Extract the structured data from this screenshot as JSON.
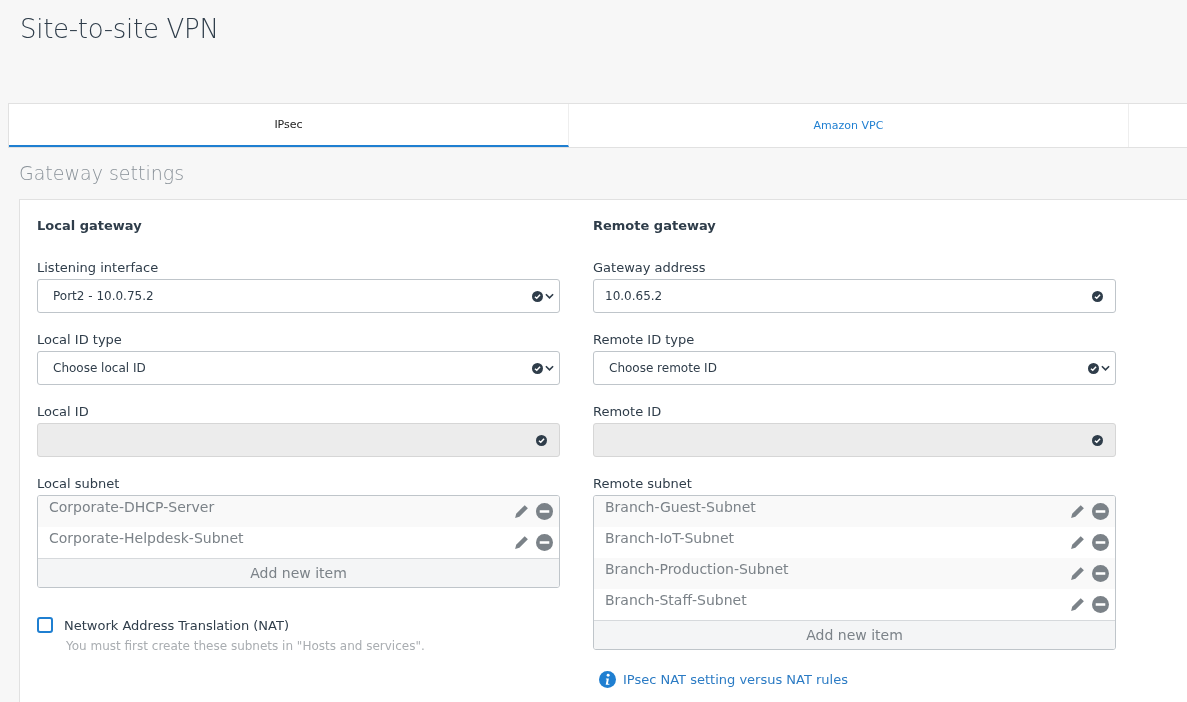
{
  "page_title": "Site-to-site VPN",
  "tabs": [
    {
      "label": "IPsec",
      "selected": true
    },
    {
      "label": "Amazon VPC",
      "selected": false
    }
  ],
  "section_title": "Gateway settings",
  "columns": [
    {
      "heading": "Local gateway",
      "fields": [
        {
          "kind": "select",
          "label": "Listening interface",
          "value": "Port2 - 10.0.75.2",
          "disabled": false
        },
        {
          "kind": "select",
          "label": "Local ID type",
          "value": "Choose local ID",
          "disabled": false
        },
        {
          "kind": "text",
          "label": "Local ID",
          "disabled": true
        },
        {
          "kind": "list",
          "label": "Local subnet",
          "items": [
            "Corporate-DHCP-Server",
            "Corporate-Helpdesk-Subnet"
          ],
          "add_label": "Add new item"
        },
        {
          "kind": "checkbox",
          "label": "Network Address Translation (NAT)",
          "checked": false,
          "hint": "You must first create these subnets in \"Hosts and services\"."
        }
      ]
    },
    {
      "heading": "Remote gateway",
      "fields": [
        {
          "kind": "text",
          "label": "Gateway address",
          "value": "10.0.65.2",
          "disabled": false
        },
        {
          "kind": "select",
          "label": "Remote ID type",
          "value": "Choose remote ID",
          "disabled": false
        },
        {
          "kind": "text",
          "label": "Remote ID",
          "disabled": true
        },
        {
          "kind": "list",
          "label": "Remote subnet",
          "items": [
            "Branch-Guest-Subnet",
            "Branch-IoT-Subnet",
            "Branch-Production-Subnet",
            "Branch-Staff-Subnet"
          ],
          "add_label": "Add new item"
        },
        {
          "kind": "link",
          "label": "IPsec NAT setting versus NAT rules"
        }
      ]
    }
  ]
}
